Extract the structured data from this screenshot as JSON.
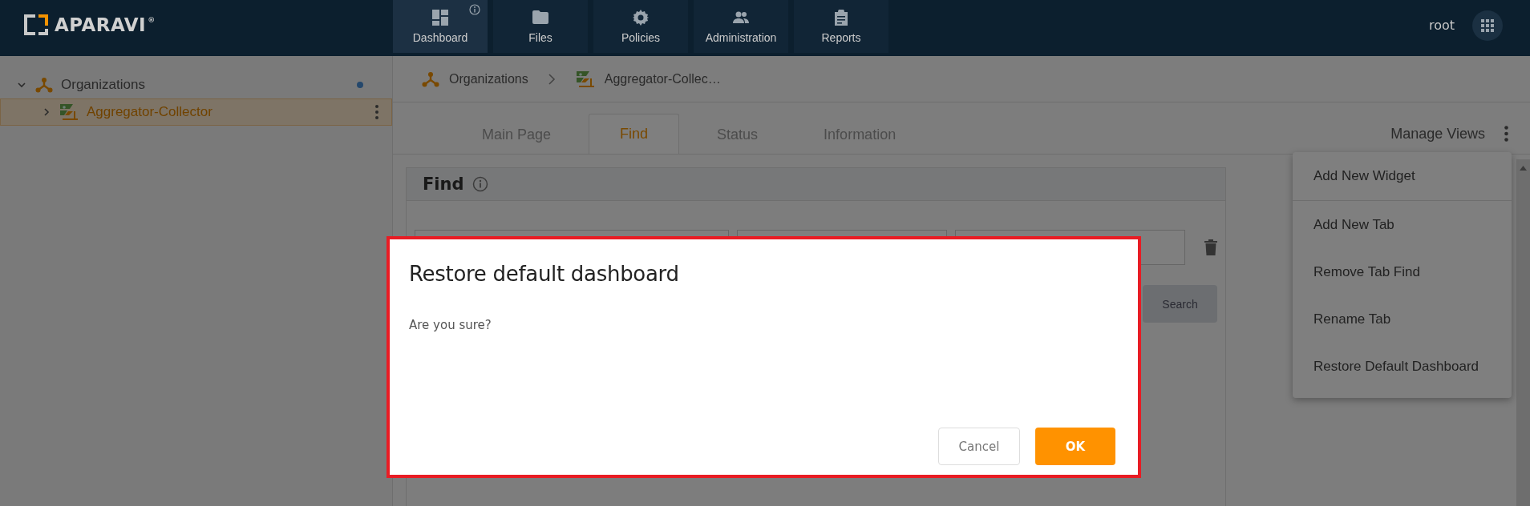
{
  "header": {
    "logo_text": "APARAVI",
    "logo_mark": "®",
    "nav": [
      {
        "label": "Dashboard",
        "selected": true,
        "info": true
      },
      {
        "label": "Files",
        "selected": false,
        "info": false
      },
      {
        "label": "Policies",
        "selected": false,
        "info": false
      },
      {
        "label": "Administration",
        "selected": false,
        "info": false
      },
      {
        "label": "Reports",
        "selected": false,
        "info": false
      }
    ],
    "user": "root"
  },
  "sidebar": {
    "tree": [
      {
        "label": "Organizations",
        "kind": "organization",
        "expanded": true,
        "selected": false,
        "children": [
          {
            "label": "Aggregator-Collector",
            "kind": "collector",
            "expanded": false,
            "selected": true
          }
        ]
      }
    ]
  },
  "breadcrumb": [
    {
      "label": "Organizations",
      "kind": "organization"
    },
    {
      "label": "Aggregator-Collec…",
      "kind": "collector"
    }
  ],
  "tabs": [
    {
      "label": "Main Page",
      "selected": false
    },
    {
      "label": "Find",
      "selected": true
    },
    {
      "label": "Status",
      "selected": false
    },
    {
      "label": "Information",
      "selected": false
    }
  ],
  "manage_views": "Manage Views",
  "find_panel": {
    "title": "Find",
    "search_button": "Search"
  },
  "menu": [
    {
      "label": "Add New Widget",
      "divider_after": true
    },
    {
      "label": "Add New Tab",
      "divider_after": false
    },
    {
      "label": "Remove Tab Find",
      "divider_after": false
    },
    {
      "label": "Rename Tab",
      "divider_after": false
    },
    {
      "label": "Restore Default Dashboard",
      "divider_after": false
    }
  ],
  "dialog": {
    "title": "Restore default dashboard",
    "message": "Are you sure?",
    "buttons": [
      {
        "label": "Cancel",
        "kind": "secondary"
      },
      {
        "label": "OK",
        "kind": "primary"
      }
    ]
  }
}
